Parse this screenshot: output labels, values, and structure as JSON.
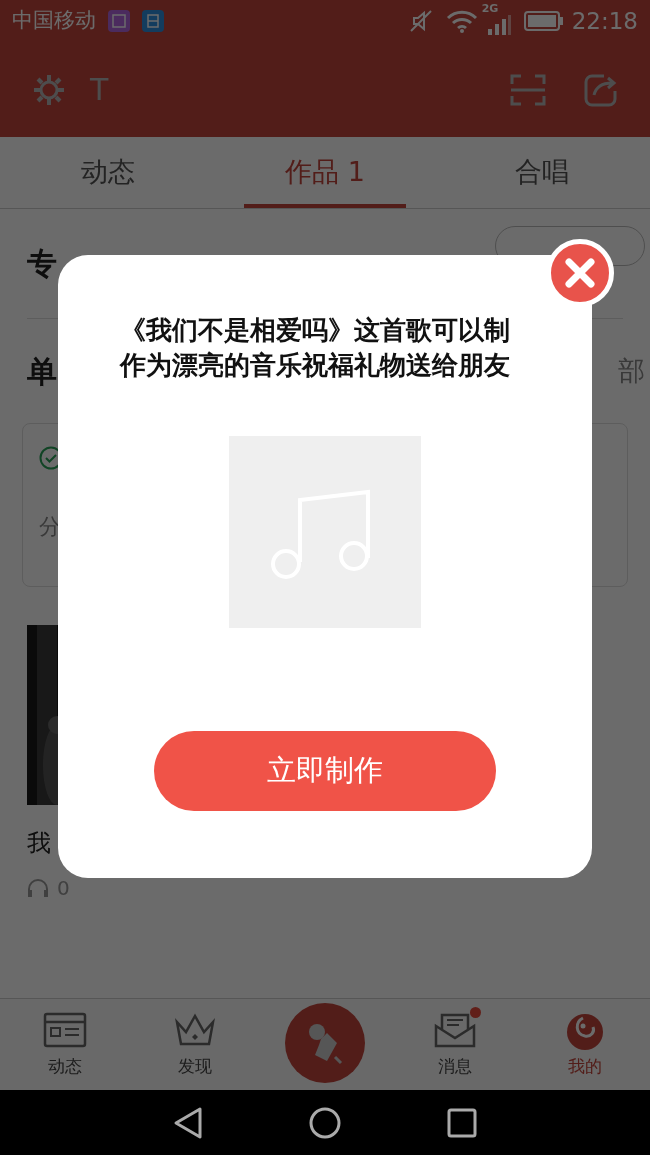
{
  "status_bar": {
    "carrier": "中国移动",
    "network": "2G",
    "time": "22:18"
  },
  "header": {
    "text_icon": "T"
  },
  "tabs": [
    {
      "label": "动态",
      "selected": false
    },
    {
      "label": "作品 1",
      "selected": true
    },
    {
      "label": "合唱",
      "selected": false
    }
  ],
  "album_section": {
    "title": "专"
  },
  "singles_section": {
    "title": "单",
    "more": "部"
  },
  "card": {
    "text": "分"
  },
  "song": {
    "title": "我",
    "plays": "0"
  },
  "bottom_nav": [
    {
      "kind": "feed",
      "label": "动态",
      "selected": false
    },
    {
      "kind": "discover",
      "label": "发现",
      "selected": false
    },
    {
      "kind": "record",
      "selected": false
    },
    {
      "kind": "messages",
      "label": "消息",
      "selected": false,
      "badge": true
    },
    {
      "kind": "me",
      "label": "我的",
      "selected": true
    }
  ],
  "dialog": {
    "message": "《我们不是相爱吗》这首歌可以制作为漂亮的音乐祝福礼物送给朋友",
    "button": "立即制作"
  }
}
